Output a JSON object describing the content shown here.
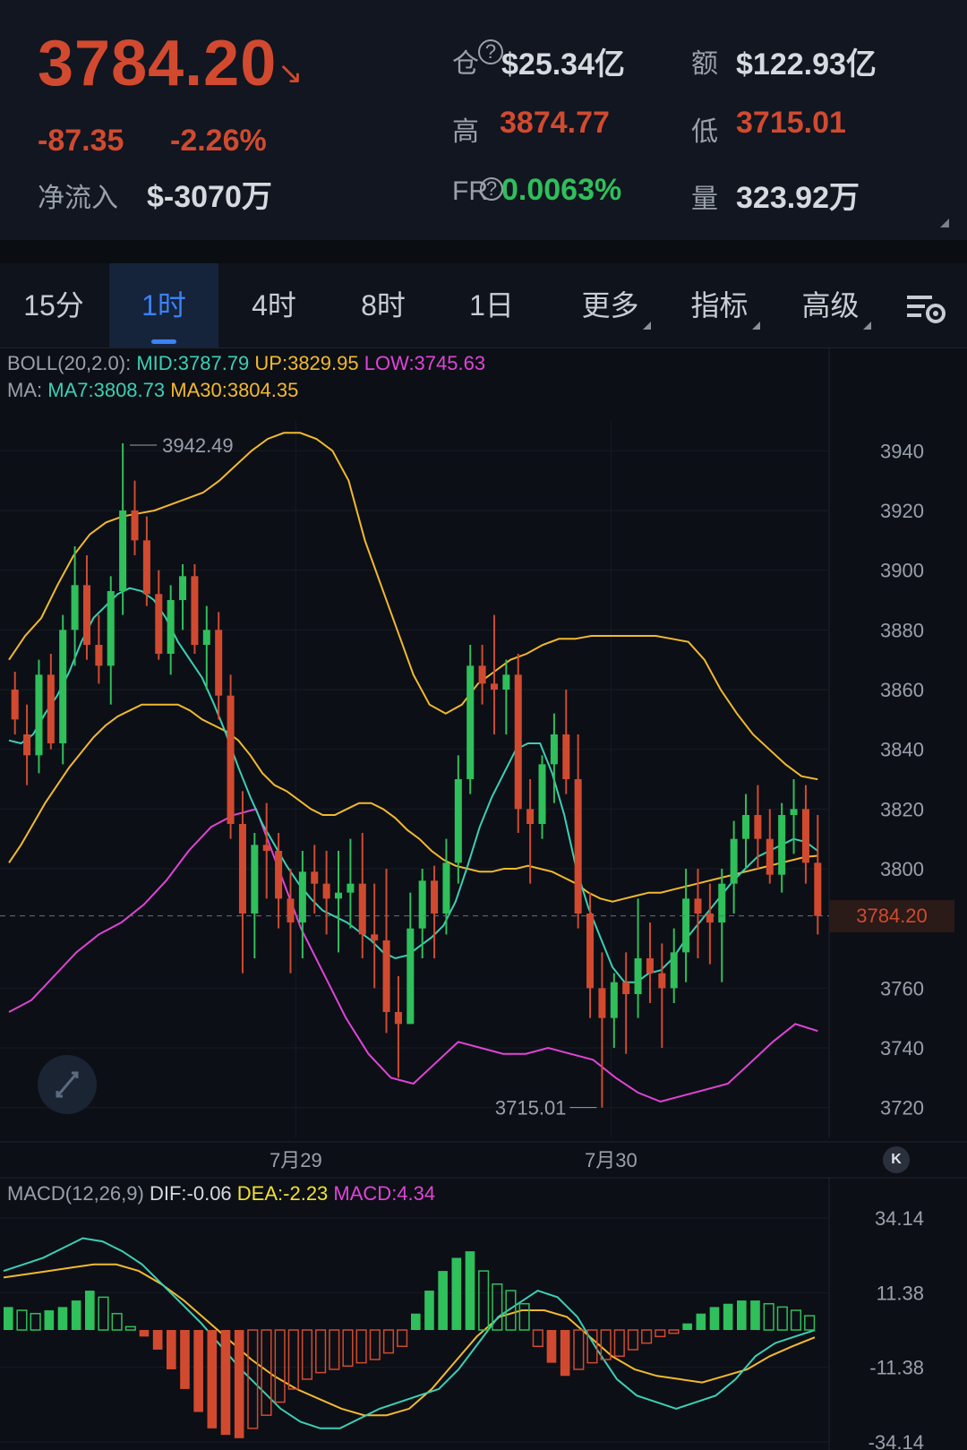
{
  "header": {
    "price": "3784.20",
    "change": "-87.35",
    "change_pct": "-2.26%",
    "netflow_label": "净流入",
    "netflow_value": "$-3070万",
    "oi_label": "仓",
    "oi_value": "$25.34亿",
    "amount_label": "额",
    "amount_value": "$122.93亿",
    "high_label": "高",
    "high_value": "3874.77",
    "low_label": "低",
    "low_value": "3715.01",
    "fr_label": "FR",
    "fr_value": "0.0063%",
    "vol_label": "量",
    "vol_value": "323.92万"
  },
  "tabs": [
    "15分",
    "1时",
    "4时",
    "8时",
    "1日",
    "更多",
    "指标",
    "高级"
  ],
  "active_tab": "1时",
  "indicators": {
    "boll_label": "BOLL(20,2.0):",
    "boll_mid": "MID:3787.79",
    "boll_up": "UP:3829.95",
    "boll_low": "LOW:3745.63",
    "ma_label": "MA:",
    "ma7": "MA7:3808.73",
    "ma30": "MA30:3804.35",
    "macd_label": "MACD(12,26,9)",
    "dif": "DIF:-0.06",
    "dea": "DEA:-2.23",
    "macd": "MACD:4.34"
  },
  "colors": {
    "up": "#2fbf5b",
    "down": "#d14a2f",
    "ma7": "#3ccfb4",
    "ma30": "#f2b92e",
    "boll_low": "#e044d6",
    "accent": "#3b82f6"
  },
  "chart_data": [
    {
      "type": "candlestick",
      "y_ticks": [
        "3940",
        "3920",
        "3900",
        "3880",
        "3860",
        "3840",
        "3820",
        "3800",
        "3760",
        "3740",
        "3720"
      ],
      "x_labels": [
        "7月29",
        "7月30"
      ],
      "annotations": {
        "max": "3942.49",
        "min": "3715.01",
        "last": "3784.20"
      },
      "ylim": [
        3710,
        3950
      ],
      "candles": [
        [
          3860,
          3866,
          3845,
          3850
        ],
        [
          3845,
          3855,
          3828,
          3838
        ],
        [
          3838,
          3870,
          3832,
          3865
        ],
        [
          3865,
          3872,
          3840,
          3842
        ],
        [
          3842,
          3885,
          3835,
          3880
        ],
        [
          3880,
          3908,
          3868,
          3895
        ],
        [
          3895,
          3905,
          3870,
          3875
        ],
        [
          3875,
          3885,
          3862,
          3868
        ],
        [
          3868,
          3898,
          3855,
          3893
        ],
        [
          3893,
          3942.49,
          3885,
          3920
        ],
        [
          3920,
          3930,
          3905,
          3910
        ],
        [
          3910,
          3918,
          3888,
          3892
        ],
        [
          3892,
          3900,
          3870,
          3872
        ],
        [
          3872,
          3895,
          3865,
          3890
        ],
        [
          3890,
          3902,
          3880,
          3898
        ],
        [
          3898,
          3902,
          3872,
          3875
        ],
        [
          3875,
          3888,
          3860,
          3880
        ],
        [
          3880,
          3886,
          3850,
          3858
        ],
        [
          3858,
          3865,
          3810,
          3815
        ],
        [
          3815,
          3826,
          3765,
          3785
        ],
        [
          3785,
          3812,
          3770,
          3808
        ],
        [
          3808,
          3822,
          3790,
          3806
        ],
        [
          3806,
          3812,
          3780,
          3790
        ],
        [
          3790,
          3800,
          3765,
          3782
        ],
        [
          3782,
          3806,
          3770,
          3799
        ],
        [
          3799,
          3808,
          3785,
          3795
        ],
        [
          3795,
          3806,
          3778,
          3790
        ],
        [
          3790,
          3806,
          3772,
          3792
        ],
        [
          3792,
          3810,
          3780,
          3795
        ],
        [
          3795,
          3812,
          3770,
          3778
        ],
        [
          3778,
          3795,
          3760,
          3776
        ],
        [
          3776,
          3800,
          3745,
          3752
        ],
        [
          3752,
          3764,
          3730,
          3748
        ],
        [
          3748,
          3792,
          3748,
          3780
        ],
        [
          3780,
          3800,
          3770,
          3796
        ],
        [
          3796,
          3801,
          3770,
          3785
        ],
        [
          3785,
          3810,
          3778,
          3802
        ],
        [
          3802,
          3838,
          3795,
          3830
        ],
        [
          3830,
          3875,
          3825,
          3868
        ],
        [
          3868,
          3875,
          3855,
          3862
        ],
        [
          3862,
          3885,
          3845,
          3860
        ],
        [
          3860,
          3870,
          3845,
          3865
        ],
        [
          3865,
          3872,
          3812,
          3820
        ],
        [
          3820,
          3830,
          3795,
          3815
        ],
        [
          3815,
          3838,
          3810,
          3835
        ],
        [
          3835,
          3852,
          3822,
          3845
        ],
        [
          3845,
          3860,
          3825,
          3830
        ],
        [
          3830,
          3845,
          3780,
          3785
        ],
        [
          3785,
          3792,
          3750,
          3760
        ],
        [
          3760,
          3772,
          3720,
          3750
        ],
        [
          3750,
          3765,
          3740,
          3762
        ],
        [
          3762,
          3772,
          3738,
          3758
        ],
        [
          3758,
          3790,
          3750,
          3770
        ],
        [
          3770,
          3782,
          3755,
          3765
        ],
        [
          3765,
          3775,
          3740,
          3760
        ],
        [
          3760,
          3780,
          3755,
          3772
        ],
        [
          3772,
          3800,
          3762,
          3790
        ],
        [
          3790,
          3800,
          3770,
          3785
        ],
        [
          3785,
          3795,
          3768,
          3782
        ],
        [
          3782,
          3800,
          3762,
          3795
        ],
        [
          3795,
          3816,
          3785,
          3810
        ],
        [
          3810,
          3825,
          3800,
          3818
        ],
        [
          3818,
          3828,
          3800,
          3810
        ],
        [
          3810,
          3820,
          3795,
          3798
        ],
        [
          3798,
          3822,
          3792,
          3818
        ],
        [
          3818,
          3830,
          3805,
          3820
        ],
        [
          3820,
          3828,
          3795,
          3802
        ],
        [
          3802,
          3818,
          3778,
          3784.2
        ]
      ],
      "ma7": [
        3843,
        3842,
        3845,
        3852,
        3858,
        3866,
        3876,
        3884,
        3888,
        3892,
        3894,
        3893,
        3890,
        3884,
        3876,
        3870,
        3864,
        3855,
        3845,
        3834,
        3824,
        3815,
        3808,
        3801,
        3795,
        3790,
        3786,
        3784,
        3782,
        3779,
        3776,
        3772,
        3770,
        3771,
        3774,
        3777,
        3781,
        3789,
        3801,
        3814,
        3824,
        3832,
        3840,
        3842,
        3842,
        3832,
        3818,
        3800,
        3787,
        3777,
        3767,
        3762,
        3762,
        3765,
        3766,
        3770,
        3776,
        3781,
        3786,
        3791,
        3796,
        3800,
        3804,
        3806,
        3808,
        3810,
        3809,
        3806
      ],
      "ma30": [
        3802,
        3808,
        3815,
        3822,
        3828,
        3834,
        3839,
        3844,
        3848,
        3851,
        3853,
        3855,
        3855,
        3855,
        3855,
        3853,
        3850,
        3848,
        3846,
        3843,
        3838,
        3832,
        3828,
        3826,
        3823,
        3820,
        3818,
        3818,
        3820,
        3822,
        3822,
        3820,
        3817,
        3813,
        3810,
        3806,
        3803,
        3801,
        3800,
        3799,
        3799,
        3800,
        3800,
        3801,
        3800,
        3799,
        3797,
        3795,
        3792,
        3790,
        3789,
        3790,
        3791,
        3792,
        3792,
        3793,
        3794,
        3795,
        3796,
        3797,
        3798,
        3799,
        3800,
        3801,
        3802,
        3803,
        3804,
        3804.35
      ],
      "boll_up": [
        3870,
        3878,
        3884,
        3895,
        3905,
        3912,
        3916,
        3918,
        3919,
        3920,
        3922,
        3924,
        3926,
        3930,
        3935,
        3940,
        3944,
        3946,
        3946,
        3944,
        3940,
        3930,
        3910,
        3895,
        3880,
        3865,
        3855,
        3852,
        3855,
        3862,
        3866,
        3870,
        3872,
        3875,
        3877,
        3877,
        3878,
        3878,
        3878,
        3878,
        3878,
        3877,
        3876,
        3870,
        3860,
        3852,
        3845,
        3840,
        3835,
        3831,
        3829.95
      ],
      "boll_low": [
        3752,
        3756,
        3764,
        3772,
        3778,
        3782,
        3788,
        3796,
        3806,
        3814,
        3818,
        3820,
        3800,
        3780,
        3765,
        3750,
        3738,
        3730,
        3728,
        3735,
        3742,
        3740,
        3738,
        3738,
        3740,
        3738,
        3736,
        3730,
        3725,
        3722,
        3724,
        3726,
        3728,
        3735,
        3742,
        3748,
        3745.63
      ],
      "macd_hist": [
        7,
        6,
        5,
        6,
        7,
        9,
        12,
        10,
        5,
        1,
        -2,
        -6,
        -12,
        -18,
        -25,
        -30,
        -32,
        -33,
        -30,
        -26,
        -22,
        -18,
        -15,
        -13,
        -12,
        -11,
        -10,
        -9,
        -7,
        -5,
        5,
        12,
        18,
        22,
        24,
        18,
        14,
        12,
        8,
        -5,
        -10,
        -14,
        -12,
        -10,
        -9,
        -8,
        -6,
        -4,
        -2,
        -1,
        2,
        5,
        7,
        8,
        9,
        9,
        8,
        7,
        6,
        4.34
      ],
      "dif": [
        18,
        20,
        22,
        25,
        28,
        27,
        24,
        20,
        14,
        8,
        2,
        -5,
        -12,
        -18,
        -24,
        -28,
        -30,
        -30,
        -27,
        -24,
        -22,
        -20,
        -18,
        -12,
        -4,
        4,
        8,
        12,
        10,
        4,
        -6,
        -15,
        -20,
        -22,
        -24,
        -22,
        -20,
        -15,
        -8,
        -4,
        -2,
        -0.06
      ],
      "dea": [
        16,
        17,
        18,
        19,
        20,
        20,
        18,
        14,
        9,
        3,
        -3,
        -9,
        -14,
        -18,
        -21,
        -24,
        -26,
        -26,
        -24,
        -18,
        -10,
        -2,
        4,
        6,
        6,
        4,
        -2,
        -8,
        -12,
        -14,
        -15,
        -16,
        -14,
        -12,
        -8,
        -5,
        -2.23
      ]
    }
  ],
  "macd_ticks": [
    "34.14",
    "11.38",
    "-11.38",
    "-34.14"
  ]
}
